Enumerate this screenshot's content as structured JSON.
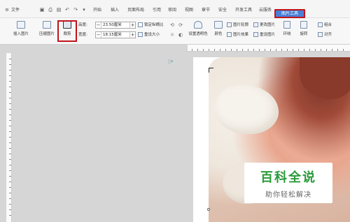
{
  "tabs": {
    "menu": "文件",
    "items": [
      "开始",
      "插入",
      "页面布局",
      "引用",
      "审阅",
      "视图",
      "章节",
      "安全",
      "开发工具",
      "云服务"
    ],
    "active": "图片工具"
  },
  "ribbon": {
    "insert_picture": "插入图片",
    "compress_picture": "压缩图片",
    "crop": "裁剪",
    "height_label": "高度:",
    "height_value": "23.50厘米",
    "width_label": "宽度:",
    "width_value": "18.15厘米",
    "lock_ratio": "锁定纵横比",
    "reset_size": "重设大小",
    "transparent": "设置透明色",
    "color": "颜色",
    "picture_outline": "图片轮廓",
    "picture_effect": "图片效果",
    "change_picture": "更改图片",
    "reset_picture": "重设图片",
    "wrap": "环绕",
    "rotate": "旋转",
    "align": "对齐",
    "group": "组合"
  },
  "watermark": {
    "title": "百科全说",
    "subtitle": "助你轻松解决"
  }
}
